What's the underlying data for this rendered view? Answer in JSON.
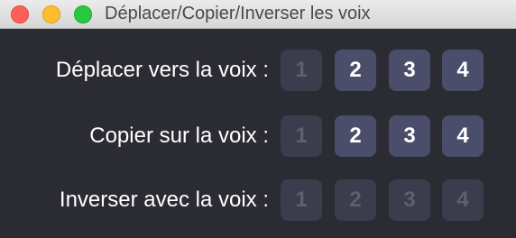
{
  "window": {
    "title": "Déplacer/Copier/Inverser les voix"
  },
  "rows": [
    {
      "label": "Déplacer vers la voix :",
      "buttons": [
        {
          "label": "1",
          "enabled": false
        },
        {
          "label": "2",
          "enabled": true
        },
        {
          "label": "3",
          "enabled": true
        },
        {
          "label": "4",
          "enabled": true
        }
      ]
    },
    {
      "label": "Copier sur la voix :",
      "buttons": [
        {
          "label": "1",
          "enabled": false
        },
        {
          "label": "2",
          "enabled": true
        },
        {
          "label": "3",
          "enabled": true
        },
        {
          "label": "4",
          "enabled": true
        }
      ]
    },
    {
      "label": "Inverser avec la voix :",
      "buttons": [
        {
          "label": "1",
          "enabled": false
        },
        {
          "label": "2",
          "enabled": false
        },
        {
          "label": "3",
          "enabled": false
        },
        {
          "label": "4",
          "enabled": false
        }
      ]
    }
  ],
  "colors": {
    "background": "#2b2b34",
    "button_enabled": "#4b4e6a",
    "button_disabled": "#3b3c4c",
    "text": "#ffffff",
    "text_disabled": "#5d5f72"
  }
}
